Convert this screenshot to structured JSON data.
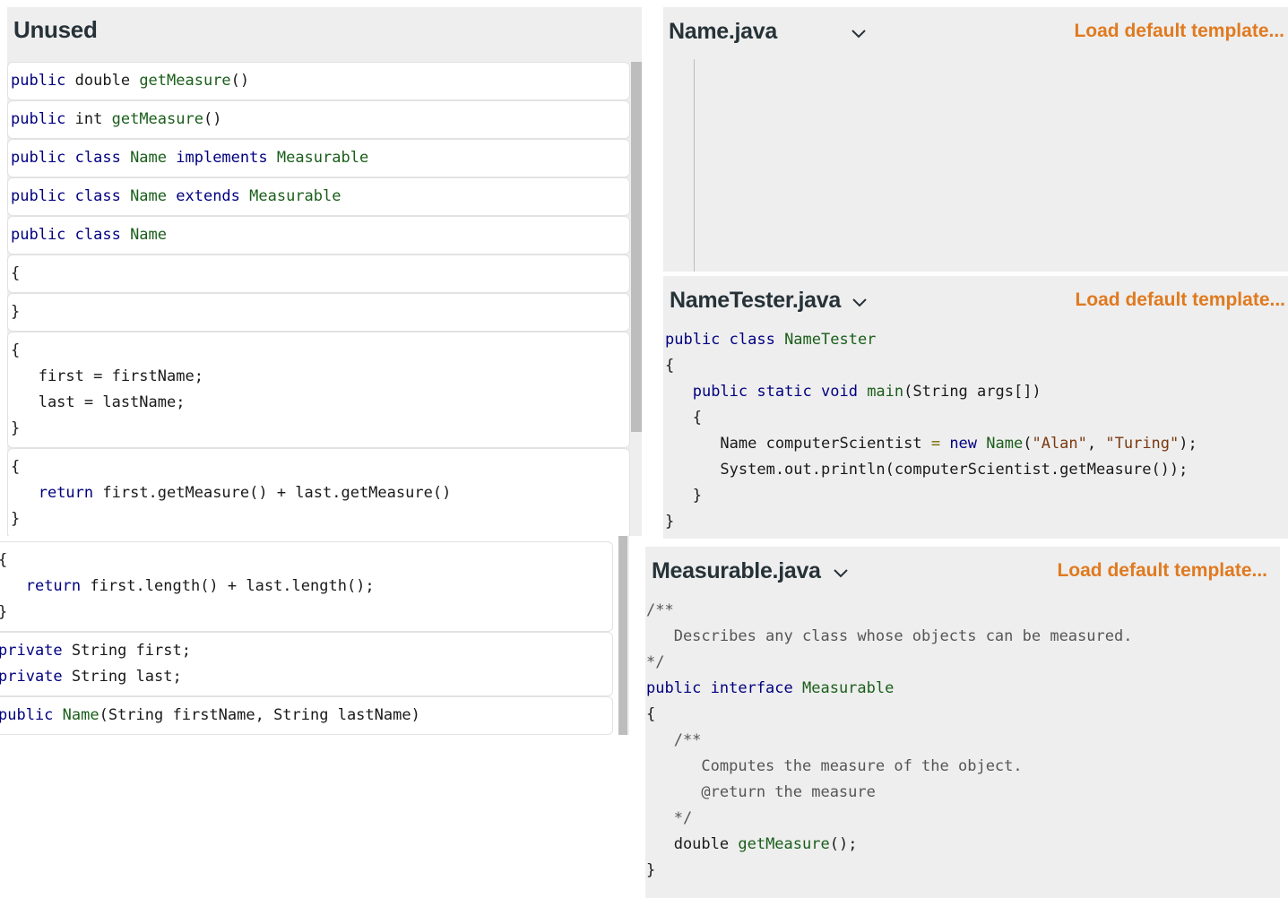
{
  "unused": {
    "title": "Unused",
    "tiles": [
      {
        "lines": [
          [
            [
              "kw",
              "public"
            ],
            [
              "pl",
              " double "
            ],
            [
              "id",
              "getMeasure"
            ],
            [
              "pl",
              "()"
            ]
          ]
        ]
      },
      {
        "lines": [
          [
            [
              "kw",
              "public"
            ],
            [
              "pl",
              " int "
            ],
            [
              "id",
              "getMeasure"
            ],
            [
              "pl",
              "()"
            ]
          ]
        ]
      },
      {
        "lines": [
          [
            [
              "kw",
              "public class "
            ],
            [
              "id",
              "Name "
            ],
            [
              "kw",
              "implements "
            ],
            [
              "id",
              "Measurable"
            ]
          ]
        ]
      },
      {
        "lines": [
          [
            [
              "kw",
              "public class "
            ],
            [
              "id",
              "Name "
            ],
            [
              "kw",
              "extends "
            ],
            [
              "id",
              "Measurable"
            ]
          ]
        ]
      },
      {
        "lines": [
          [
            [
              "kw",
              "public class "
            ],
            [
              "id",
              "Name"
            ]
          ]
        ]
      },
      {
        "lines": [
          [
            [
              "pl",
              "{"
            ]
          ]
        ]
      },
      {
        "lines": [
          [
            [
              "pl",
              "}"
            ]
          ]
        ]
      },
      {
        "lines": [
          [
            [
              "pl",
              "{"
            ]
          ],
          [
            [
              "pl",
              "   first = firstName;"
            ]
          ],
          [
            [
              "pl",
              "   last = lastName;"
            ]
          ],
          [
            [
              "pl",
              "}"
            ]
          ]
        ]
      },
      {
        "lines": [
          [
            [
              "pl",
              "{"
            ]
          ],
          [
            [
              "pl",
              "   "
            ],
            [
              "kw",
              "return"
            ],
            [
              "pl",
              " first.getMeasure() + last.getMeasure()"
            ]
          ],
          [
            [
              "pl",
              "}"
            ]
          ]
        ]
      }
    ]
  },
  "dragged": {
    "tiles": [
      {
        "lines": [
          [
            [
              "pl",
              "{"
            ]
          ],
          [
            [
              "pl",
              "   "
            ],
            [
              "kw",
              "return"
            ],
            [
              "pl",
              " first.length() + last.length();"
            ]
          ],
          [
            [
              "pl",
              "}"
            ]
          ]
        ]
      },
      {
        "lines": [
          [
            [
              "kw",
              "private"
            ],
            [
              "pl",
              " String first;"
            ]
          ],
          [
            [
              "kw",
              "private"
            ],
            [
              "pl",
              " String last;"
            ]
          ]
        ]
      },
      {
        "lines": [
          [
            [
              "kw",
              "public "
            ],
            [
              "id",
              "Name"
            ],
            [
              "pl",
              "(String firstName, String lastName)"
            ]
          ]
        ]
      }
    ]
  },
  "files": {
    "name": {
      "title": "Name.java",
      "load_label": "Load default template...",
      "lines": []
    },
    "tester": {
      "title": "NameTester.java",
      "load_label": "Load default template...",
      "lines": [
        [
          [
            "kw",
            "public class "
          ],
          [
            "id",
            "NameTester"
          ]
        ],
        [
          [
            "pl",
            "{"
          ]
        ],
        [
          [
            "pl",
            "   "
          ],
          [
            "kw",
            "public static void "
          ],
          [
            "id",
            "main"
          ],
          [
            "pl",
            "(String args[])"
          ]
        ],
        [
          [
            "pl",
            "   {"
          ]
        ],
        [
          [
            "pl",
            "      Name computerScientist "
          ],
          [
            "op",
            "="
          ],
          [
            "pl",
            " "
          ],
          [
            "kw",
            "new "
          ],
          [
            "id",
            "Name"
          ],
          [
            "pl",
            "("
          ],
          [
            "str",
            "\"Alan\""
          ],
          [
            "pl",
            ", "
          ],
          [
            "str",
            "\"Turing\""
          ],
          [
            "pl",
            ");"
          ]
        ],
        [
          [
            "pl",
            "      System.out.println(computerScientist.getMeasure());"
          ]
        ],
        [
          [
            "pl",
            "   }"
          ]
        ],
        [
          [
            "pl",
            "}"
          ]
        ]
      ]
    },
    "measurable": {
      "title": "Measurable.java",
      "load_label": "Load default template...",
      "lines": [
        [
          [
            "cm",
            "/**"
          ]
        ],
        [
          [
            "cm",
            "   Describes any class whose objects can be measured."
          ]
        ],
        [
          [
            "cm",
            "*/"
          ]
        ],
        [
          [
            "kw",
            "public interface "
          ],
          [
            "id",
            "Measurable"
          ]
        ],
        [
          [
            "pl",
            "{"
          ]
        ],
        [
          [
            "cm",
            "   /**"
          ]
        ],
        [
          [
            "cm",
            "      Computes the measure of the object."
          ]
        ],
        [
          [
            "cm",
            "      @return the measure"
          ]
        ],
        [
          [
            "cm",
            "   */"
          ]
        ],
        [
          [
            "pl",
            "   double "
          ],
          [
            "id",
            "getMeasure"
          ],
          [
            "pl",
            "();"
          ]
        ],
        [
          [
            "pl",
            "}"
          ]
        ]
      ]
    }
  },
  "colors": {
    "accent": "#e07a1f",
    "keyword": "#000080",
    "identifier": "#1a5e1a",
    "string": "#7a3a10",
    "heading": "#263238"
  }
}
